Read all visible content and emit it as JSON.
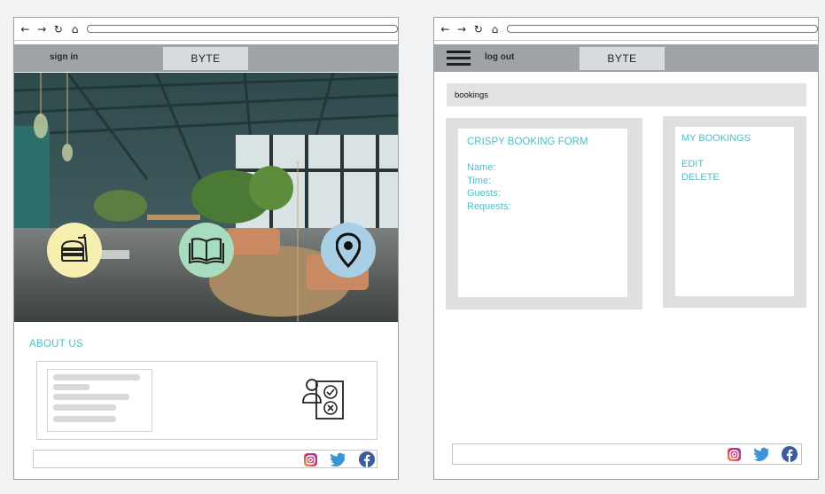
{
  "left_window": {
    "header": {
      "signin_label": "sign in",
      "brand_label": "BYTE"
    },
    "hero": {
      "icons": [
        "food-drink-icon",
        "book-icon",
        "location-pin-icon"
      ],
      "icon_colors": [
        "#f7efb0",
        "#a8dcbf",
        "#a8cfe6"
      ]
    },
    "about": {
      "title": "ABOUT US"
    },
    "footer": {
      "social_icons": [
        "instagram-icon",
        "twitter-icon",
        "facebook-icon"
      ]
    }
  },
  "right_window": {
    "header": {
      "logout_label": "log out",
      "brand_label": "BYTE"
    },
    "breadcrumb": "bookings",
    "booking_form": {
      "title": "CRISPY BOOKING FORM",
      "fields": [
        "Name:",
        "Time:",
        "Guests:",
        "Requests:"
      ]
    },
    "my_bookings": {
      "title": "MY BOOKINGS",
      "actions": [
        "EDIT",
        "DELETE"
      ]
    },
    "footer": {
      "social_icons": [
        "instagram-icon",
        "twitter-icon",
        "facebook-icon"
      ]
    }
  },
  "colors": {
    "accent": "#4fbcc7",
    "header_bar": "#9ea3a8",
    "panel_gray": "#dfdfdf"
  }
}
